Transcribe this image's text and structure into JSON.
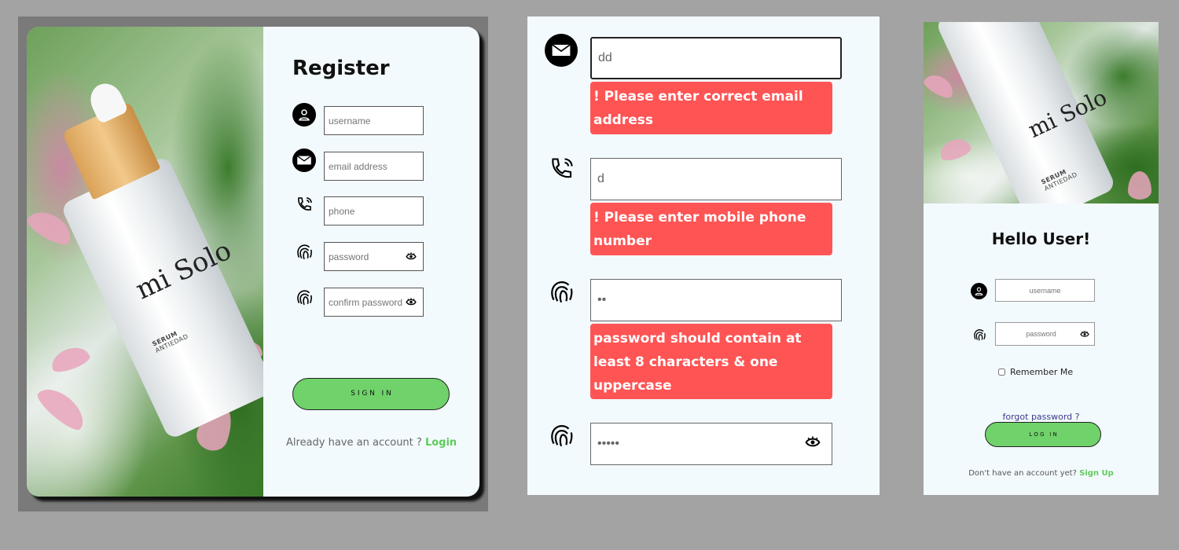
{
  "register": {
    "title": "Register",
    "fields": {
      "username": {
        "placeholder": "username",
        "value": ""
      },
      "email": {
        "placeholder": "email address",
        "value": ""
      },
      "phone": {
        "placeholder": "phone",
        "value": ""
      },
      "password": {
        "placeholder": "password",
        "value": ""
      },
      "confirm": {
        "placeholder": "confirm password",
        "value": ""
      }
    },
    "sign_in_label": "S I G N   I N",
    "already_text": "Already have an account ? ",
    "login_link": "Login",
    "image": {
      "brand": "mi Solo",
      "product": "SERUM",
      "subtitle": "ANTIEDAD"
    }
  },
  "validation": {
    "email": {
      "value": "dd",
      "error": "! Please enter correct email address",
      "icon": "envelope-icon"
    },
    "phone": {
      "value": "d",
      "error": "! Please enter mobile phone number",
      "icon": "phone-icon"
    },
    "password": {
      "value": "••",
      "error": "password should contain at least 8 characters & one uppercase",
      "icon": "fingerprint-icon"
    },
    "confirm": {
      "value": "•••••",
      "icon": "fingerprint-icon"
    }
  },
  "login": {
    "title": "Hello User!",
    "fields": {
      "username": {
        "placeholder": "username"
      },
      "password": {
        "placeholder": "password"
      }
    },
    "remember_label": "Remember Me",
    "forgot_label": "forgot password ?",
    "login_label": "L O G   I N",
    "dont_text": "Don't have an account yet? ",
    "signup_link": "Sign Up"
  },
  "colors": {
    "accent_green": "#6fd26a",
    "error_red": "#ff5454",
    "card_bg": "#f3fafe",
    "page_bg": "#a3a3a3"
  }
}
